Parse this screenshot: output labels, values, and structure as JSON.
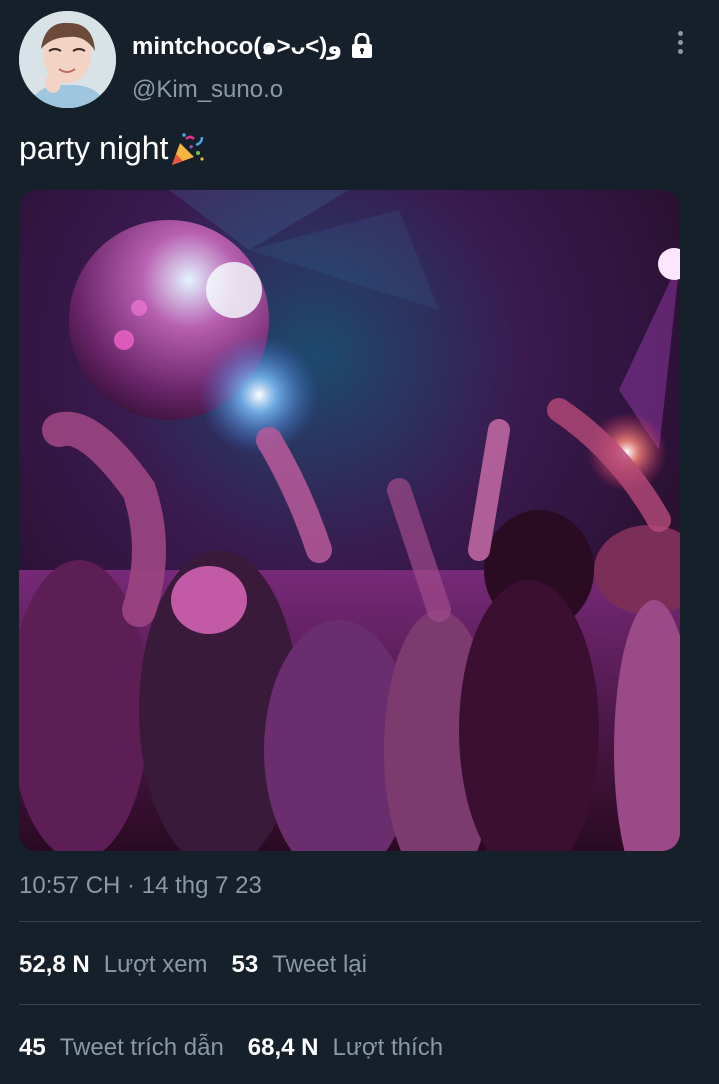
{
  "tweet": {
    "display_name": "mintchoco(๑>ᴗ<)و",
    "handle": "@Kim_suno.o",
    "text": "party night",
    "timestamp": "10:57 CH · 14 thg 7 23"
  },
  "icons": {
    "lock": "lock-icon",
    "more": "more-vertical-icon",
    "party": "party-popper-icon"
  },
  "stats": {
    "views": {
      "value": "52,8 N",
      "label": "Lượt xem"
    },
    "retweets": {
      "value": "53",
      "label": "Tweet lại"
    },
    "quotes": {
      "value": "45",
      "label": "Tweet trích dẫn"
    },
    "likes": {
      "value": "68,4 N",
      "label": "Lượt thích"
    }
  },
  "colors": {
    "background": "#15202b",
    "secondary_text": "#8b98a5",
    "divider": "#38444d"
  }
}
